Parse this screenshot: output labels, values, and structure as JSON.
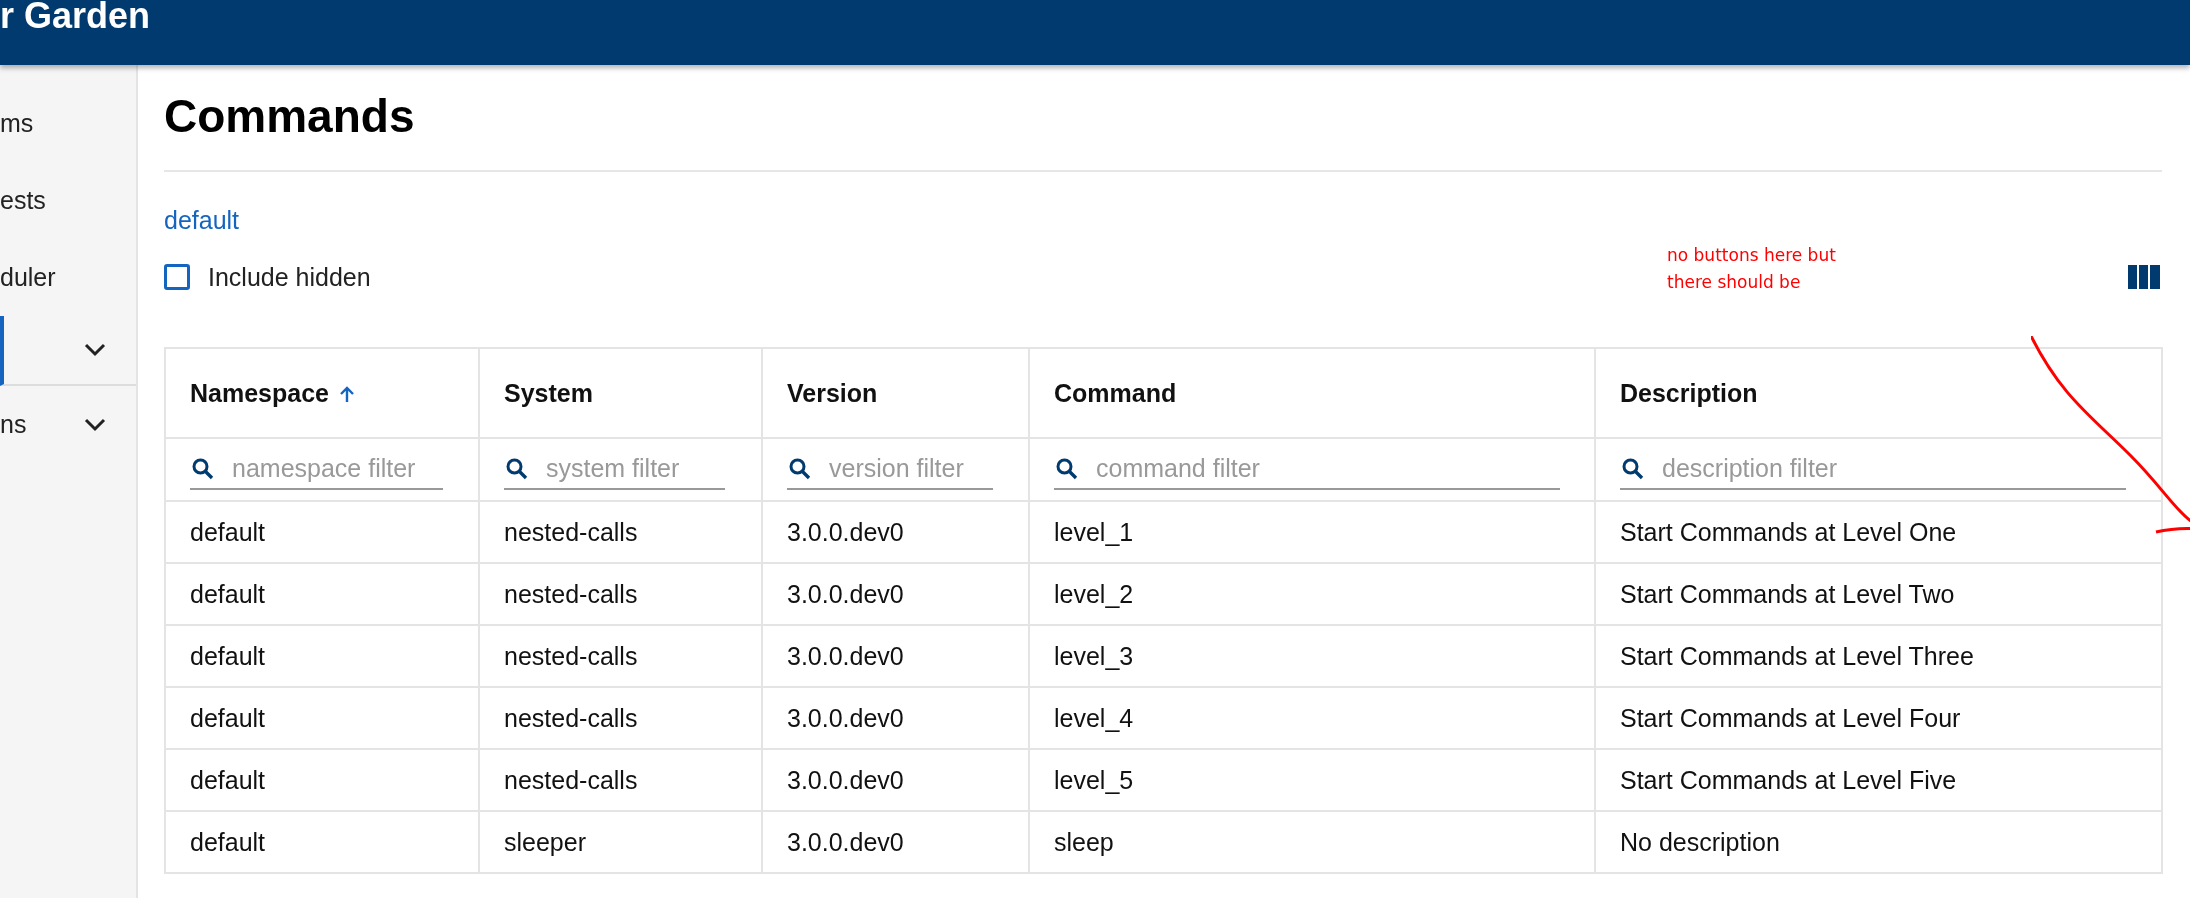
{
  "header": {
    "title": "r Garden"
  },
  "sidebar": {
    "items": [
      {
        "kind": "link",
        "label": "ms",
        "selected": false,
        "divider_after": false
      },
      {
        "kind": "link",
        "label": "ests",
        "selected": false,
        "divider_after": false
      },
      {
        "kind": "link",
        "label": "duler",
        "selected": false,
        "divider_after": false
      },
      {
        "kind": "group",
        "selected": true,
        "divider_after": true
      },
      {
        "kind": "group",
        "label": "ns",
        "selected": false,
        "divider_after": false
      }
    ]
  },
  "page": {
    "title": "Commands",
    "namespace_link": "default",
    "include_hidden": {
      "label": "Include hidden",
      "checked": false
    }
  },
  "annotation": {
    "text": "no buttons here but there should be",
    "color": "#ff0000"
  },
  "table": {
    "columns": [
      {
        "label": "Namespace",
        "sorted": true,
        "filter_placeholder": "namespace filter"
      },
      {
        "label": "System",
        "sorted": false,
        "filter_placeholder": "system filter"
      },
      {
        "label": "Version",
        "sorted": false,
        "filter_placeholder": "version filter"
      },
      {
        "label": "Command",
        "sorted": false,
        "filter_placeholder": "command filter"
      },
      {
        "label": "Description",
        "sorted": false,
        "filter_placeholder": "description filter"
      }
    ],
    "rows": [
      [
        "default",
        "nested-calls",
        "3.0.0.dev0",
        "level_1",
        "Start Commands at Level One"
      ],
      [
        "default",
        "nested-calls",
        "3.0.0.dev0",
        "level_2",
        "Start Commands at Level Two"
      ],
      [
        "default",
        "nested-calls",
        "3.0.0.dev0",
        "level_3",
        "Start Commands at Level Three"
      ],
      [
        "default",
        "nested-calls",
        "3.0.0.dev0",
        "level_4",
        "Start Commands at Level Four"
      ],
      [
        "default",
        "nested-calls",
        "3.0.0.dev0",
        "level_5",
        "Start Commands at Level Five"
      ],
      [
        "default",
        "sleeper",
        "3.0.0.dev0",
        "sleep",
        "No description"
      ]
    ]
  }
}
